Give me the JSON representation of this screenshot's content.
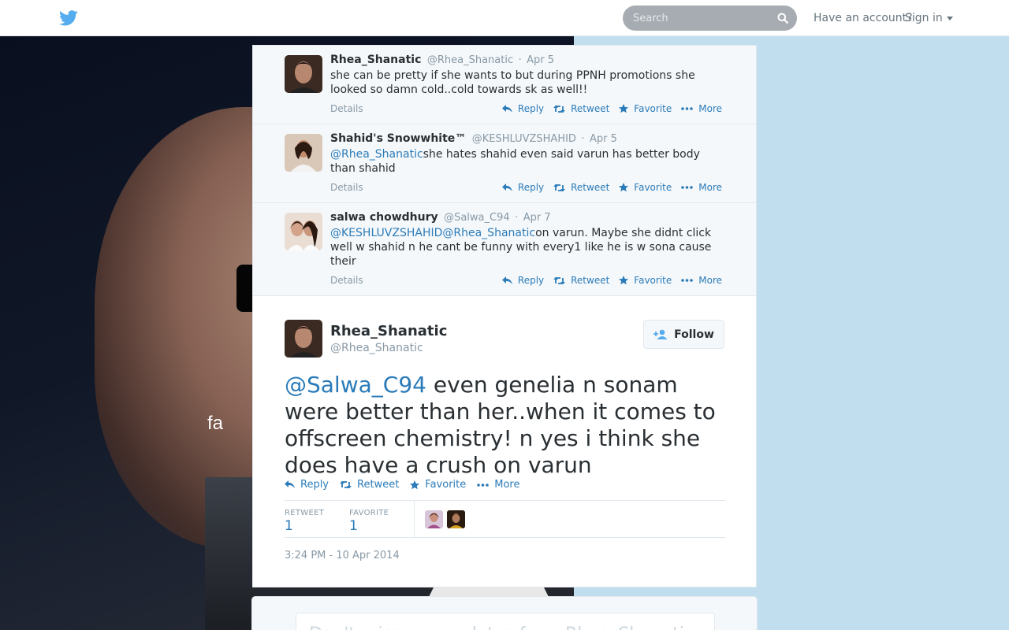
{
  "topbar": {
    "search_placeholder": "Search",
    "have_account": "Have an account?",
    "sign_in": "Sign in"
  },
  "background": {
    "overlay_text": "fa"
  },
  "replies": [
    {
      "fullname": "Rhea_Shanatic",
      "username": "@Rhea_Shanatic",
      "time": "Apr 5",
      "text": "she can be pretty if she wants to but during PPNH promotions she looked so damn cold..cold towards sk as well!!",
      "mentions": []
    },
    {
      "fullname": "Shahid's Snowwhite™",
      "username": "@KESHLUVZSHAHID",
      "time": "Apr 5",
      "mentions": [
        "@Rhea_Shanatic"
      ],
      "text": "she hates shahid even said varun has better body than shahid"
    },
    {
      "fullname": "salwa chowdhury",
      "username": "@Salwa_C94",
      "time": "Apr 7",
      "mentions": [
        "@KESHLUVZSHAHID",
        "@Rhea_Shanatic"
      ],
      "text": "on varun. Maybe she didnt click well w shahid n he cant be funny with every1 like he is w sona cause their"
    }
  ],
  "labels": {
    "details": "Details",
    "reply": "Reply",
    "retweet": "Retweet",
    "favorite": "Favorite",
    "more": "More",
    "follow": "Follow",
    "retweet_stat": "RETWEET",
    "favorite_stat": "FAVORITE"
  },
  "main_tweet": {
    "fullname": "Rhea_Shanatic",
    "username": "@Rhea_Shanatic",
    "mention": "@Salwa_C94",
    "text": " even genelia n sonam were better than her..when it comes to offscreen chemistry! n yes i think she does have a crush on varun",
    "retweet_count": "1",
    "favorite_count": "1",
    "timestamp": "3:24 PM - 10 Apr 2014"
  },
  "bottom": {
    "text": "Don't miss any updates from Rhea_Shanatic"
  },
  "colors": {
    "link": "#2b7bb9",
    "muted": "#8899a6",
    "background": "#c0deed"
  }
}
